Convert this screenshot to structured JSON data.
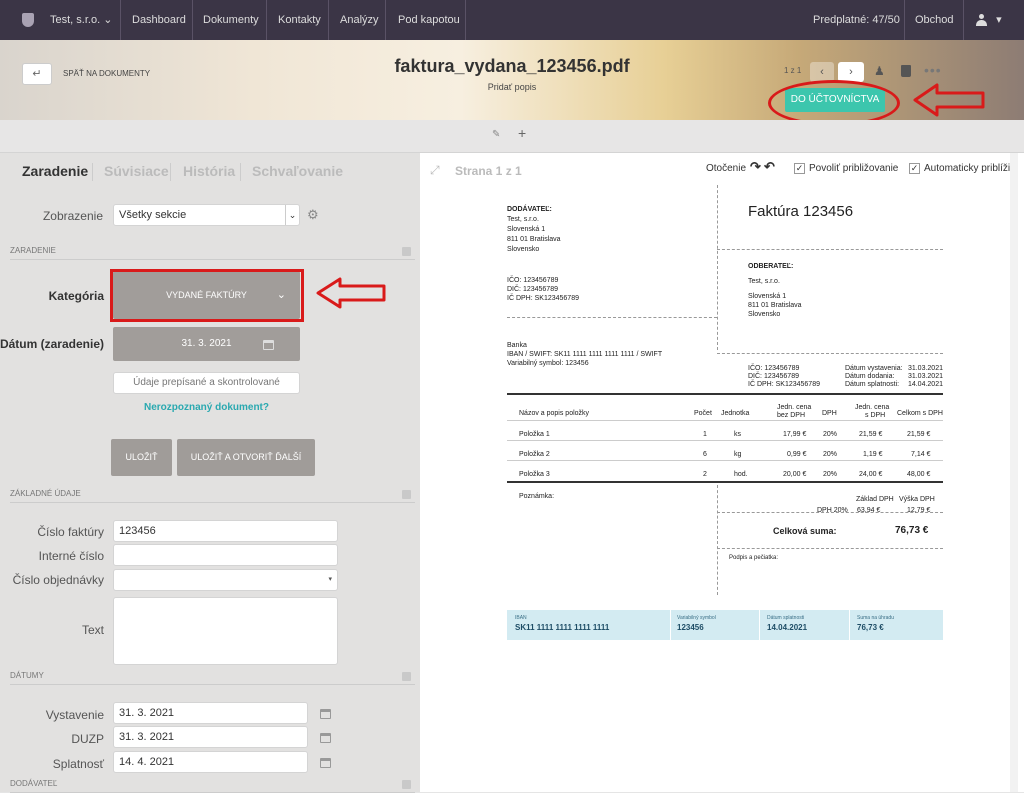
{
  "nav": {
    "company": "Test, s.r.o.",
    "items": [
      "Dashboard",
      "Dokumenty",
      "Kontakty",
      "Analýzy",
      "Pod kapotou"
    ],
    "subscription": "Predplatné: 47/50",
    "shop": "Obchod"
  },
  "header": {
    "back_label": "SPÄŤ NA DOKUMENTY",
    "filename": "faktura_vydana_123456.pdf",
    "add_desc": "Pridať popis",
    "pager": "1 z 1",
    "accounting_button": "DO ÚČTOVNÍCTVA"
  },
  "tabs": [
    "Zaradenie",
    "Súvisiace",
    "História",
    "Schvaľovanie"
  ],
  "form": {
    "view_label": "Zobrazenie",
    "view_value": "Všetky sekcie",
    "section_zaradenie": "ZARADENIE",
    "category_label": "Kategória",
    "category_value": "VYDANÉ FAKTÚRY",
    "date_label": "Dátum (zaradenie)",
    "date_value": "31. 3. 2021",
    "verified_button": "Údaje prepísané a skontrolované",
    "unrecognized_link": "Nerozpoznaný dokument?",
    "save_button": "ULOŽIŤ",
    "save_next_button": "ULOŽIŤ A OTVORIŤ ĎALŠÍ",
    "section_basic": "ZÁKLADNÉ ÚDAJE",
    "invoice_no_label": "Číslo faktúry",
    "invoice_no_value": "123456",
    "internal_no_label": "Interné číslo",
    "internal_no_value": "",
    "order_no_label": "Číslo objednávky",
    "order_no_value": "",
    "text_label": "Text",
    "text_value": "",
    "section_dates": "DÁTUMY",
    "issued_label": "Vystavenie",
    "issued_value": "31. 3. 2021",
    "duzp_label": "DUZP",
    "duzp_value": "31. 3. 2021",
    "due_label": "Splatnosť",
    "due_value": "14. 4. 2021",
    "section_supplier": "DODÁVATEĽ"
  },
  "viewer": {
    "page_label": "Strana 1 z 1",
    "rotate_label": "Otočenie",
    "zoom_allow": "Povoliť približovanie",
    "zoom_auto": "Automaticky priblížiť"
  },
  "invoice": {
    "title": "Faktúra 123456",
    "supplier_hdr": "DODÁVATEĽ:",
    "supplier_lines": [
      "Test, s.r.o.",
      "Slovenská 1",
      "811 01 Bratislava",
      "Slovensko"
    ],
    "supplier_ids": [
      "IČO: 123456789",
      "DIČ: 123456789",
      "IČ DPH: SK123456789"
    ],
    "bank_lines": [
      "Banka",
      "IBAN / SWIFT: SK11 1111 1111 1111 1111 / SWIFT",
      "Variabilný symbol: 123456"
    ],
    "customer_hdr": "ODBERATEĽ:",
    "customer_lines": [
      "Test, s.r.o.",
      "Slovenská 1",
      "811 01 Bratislava",
      "Slovensko"
    ],
    "customer_ids": [
      "IČO: 123456789",
      "DIČ: 123456789",
      "IČ DPH: SK123456789"
    ],
    "date_labels": [
      "Dátum vystavenia:",
      "Dátum dodania:",
      "Dátum splatnosti:"
    ],
    "date_values": [
      "31.03.2021",
      "31.03.2021",
      "14.04.2021"
    ],
    "col_name": "Názov a popis položky",
    "col_qty": "Počet",
    "col_unit": "Jednotka",
    "col_price_a": "Jedn. cena",
    "col_price_b": "bez DPH",
    "col_vat": "DPH",
    "col_pricevat_a": "Jedn. cena",
    "col_pricevat_b": "s DPH",
    "col_total": "Celkom s DPH",
    "rows": [
      {
        "name": "Položka 1",
        "qty": "1",
        "unit": "ks",
        "price": "17,99 €",
        "vat": "20%",
        "pricevat": "21,59 €",
        "total": "21,59 €"
      },
      {
        "name": "Položka 2",
        "qty": "6",
        "unit": "kg",
        "price": "0,99 €",
        "vat": "20%",
        "pricevat": "1,19 €",
        "total": "7,14 €"
      },
      {
        "name": "Položka 3",
        "qty": "2",
        "unit": "hod.",
        "price": "20,00 €",
        "vat": "20%",
        "pricevat": "24,00 €",
        "total": "48,00 €"
      }
    ],
    "note_label": "Poznámka:",
    "base_label": "Základ DPH",
    "vat_amount_label": "Výška DPH",
    "vat_rate": "DPH 20%",
    "base_value": "63,94 €",
    "vat_value": "12,79 €",
    "total_label": "Celková suma:",
    "total_value": "76,73 €",
    "signature_label": "Podpis a pečiatka:",
    "pay_iban_label": "IBAN",
    "pay_iban": "SK11 1111 1111 1111 1111",
    "pay_vs_label": "Variabilný symbol",
    "pay_vs": "123456",
    "pay_due_label": "Dátum splatnosti",
    "pay_due": "14.04.2021",
    "pay_sum_label": "Suma na úhradu",
    "pay_sum": "76,73 €"
  },
  "colors": {
    "accent": "#3cc6ad",
    "topbar": "#3b3546",
    "highlight": "#d91a1a",
    "link": "#2aa9b0",
    "button_gray": "#a09c99"
  }
}
